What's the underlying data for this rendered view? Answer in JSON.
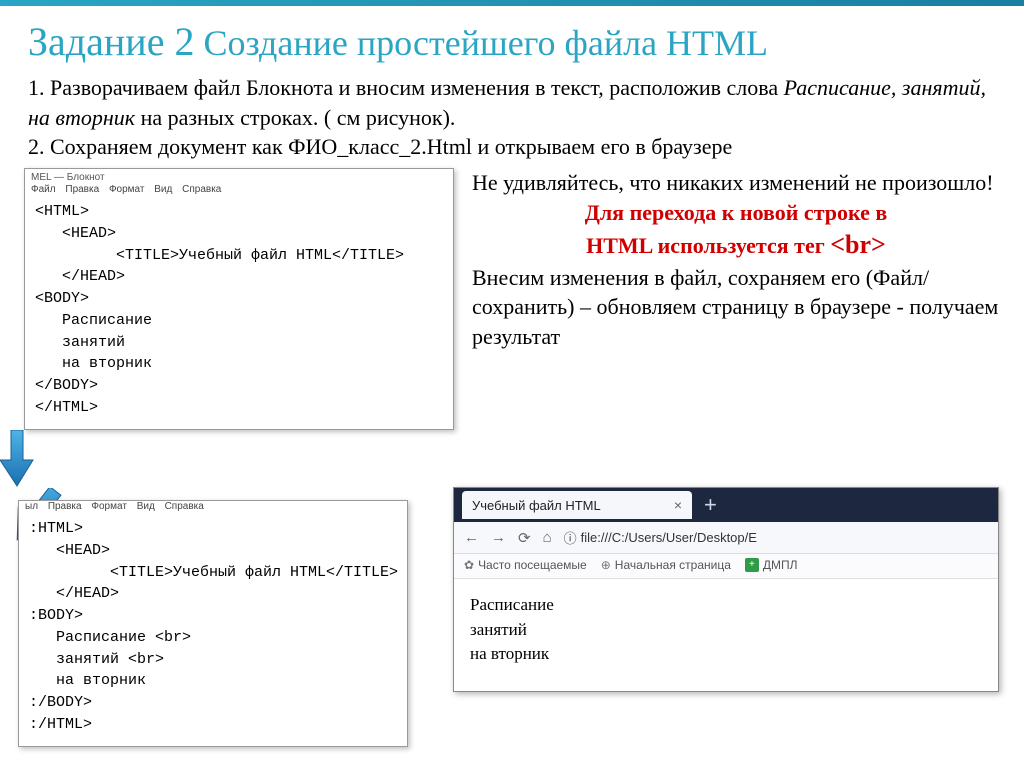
{
  "title": {
    "prefix": "Задание 2",
    "rest": " Создание простейшего файла HTML"
  },
  "para1_a": "1. Разворачиваем файл Блокнота и вносим изменения в текст, расположив слова ",
  "para1_em": "Расписание, занятий, на вторник",
  "para1_b": " на разных строках. ( см рисунок).",
  "para2": "2. Сохраняем документ как ФИО_класс_2.Html и открываем его в браузере",
  "notepad1": {
    "title": "MEL — Блокнот",
    "menus": [
      "Файл",
      "Правка",
      "Формат",
      "Вид",
      "Справка"
    ],
    "code": "<HTML>\n   <HEAD>\n         <TITLE>Учебный файл HTML</TITLE>\n   </HEAD>\n<BODY>\n   Расписание\n   занятий\n   на вторник\n</BODY>\n</HTML>"
  },
  "right": {
    "l1": "Не удивляйтесь, что никаких изменений не произошло!",
    "red1": "Для перехода к новой строке в",
    "red2a": "HTML используется тег ",
    "red2b": "<br>",
    "l3": "Внесим изменения в файл, сохраняем его (Файл/сохранить) – обновляем страницу в браузере - получаем результат"
  },
  "notepad2": {
    "menus": [
      "ыл",
      "Правка",
      "Формат",
      "Вид",
      "Справка"
    ],
    "code": ":HTML>\n   <HEAD>\n         <TITLE>Учебный файл HTML</TITLE>\n   </HEAD>\n:BODY>\n   Расписание <br>\n   занятий <br>\n   на вторник\n:/BODY>\n:/HTML>"
  },
  "browser": {
    "tab": "Учебный файл HTML",
    "url_prefix": "file:///C:/Users/User/Desktop/E",
    "bookmarks": {
      "a": "Часто посещаемые",
      "b": "Начальная страница",
      "c": "ДМПЛ"
    },
    "content_lines": [
      "Расписание",
      "занятий",
      "на вторник"
    ]
  }
}
